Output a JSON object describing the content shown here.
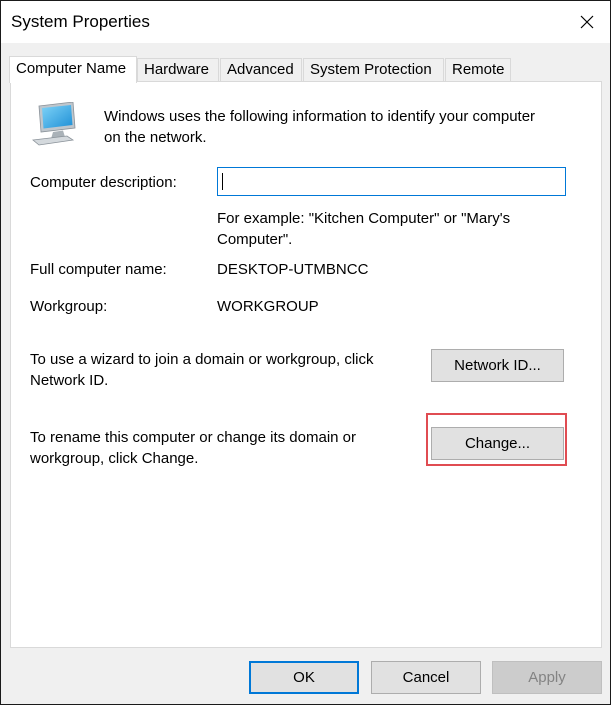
{
  "window": {
    "title": "System Properties"
  },
  "tabs": [
    {
      "label": "Computer Name",
      "active": true
    },
    {
      "label": "Hardware",
      "active": false
    },
    {
      "label": "Advanced",
      "active": false
    },
    {
      "label": "System Protection",
      "active": false
    },
    {
      "label": "Remote",
      "active": false
    }
  ],
  "intro": {
    "icon": "computer-monitor-icon",
    "text_line1": "Windows uses the following information to identify your computer",
    "text_line2": "on the network."
  },
  "description": {
    "label": "Computer description:",
    "value": "",
    "example_line1": "For example: \"Kitchen Computer\" or \"Mary's",
    "example_line2": "Computer\"."
  },
  "full_name": {
    "label": "Full computer name:",
    "value": "DESKTOP-UTMBNCC"
  },
  "workgroup": {
    "label": "Workgroup:",
    "value": "WORKGROUP"
  },
  "network_id": {
    "text_line1": "To use a wizard to join a domain or workgroup, click",
    "text_line2": "Network ID.",
    "button": "Network ID..."
  },
  "change": {
    "text_line1": "To rename this computer or change its domain or",
    "text_line2": "workgroup, click Change.",
    "button": "Change...",
    "highlight_color": "#e04c52"
  },
  "footer": {
    "ok": "OK",
    "cancel": "Cancel",
    "apply": "Apply"
  },
  "colors": {
    "focus_blue": "#0078d7",
    "dialog_bg": "#f0f0f0",
    "panel_bg": "#ffffff"
  }
}
